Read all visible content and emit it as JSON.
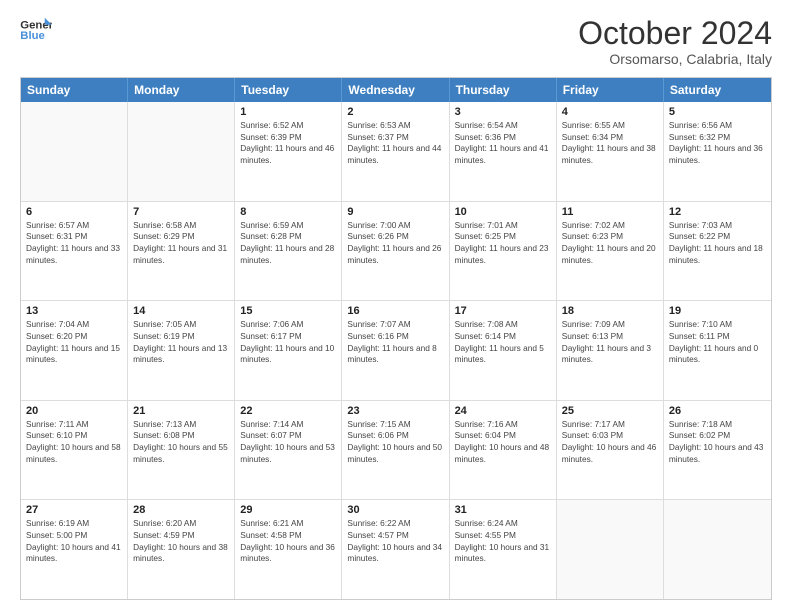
{
  "header": {
    "logo_line1": "General",
    "logo_line2": "Blue",
    "month_title": "October 2024",
    "location": "Orsomarso, Calabria, Italy"
  },
  "weekdays": [
    "Sunday",
    "Monday",
    "Tuesday",
    "Wednesday",
    "Thursday",
    "Friday",
    "Saturday"
  ],
  "rows": [
    [
      {
        "day": "",
        "info": ""
      },
      {
        "day": "",
        "info": ""
      },
      {
        "day": "1",
        "info": "Sunrise: 6:52 AM\nSunset: 6:39 PM\nDaylight: 11 hours and 46 minutes."
      },
      {
        "day": "2",
        "info": "Sunrise: 6:53 AM\nSunset: 6:37 PM\nDaylight: 11 hours and 44 minutes."
      },
      {
        "day": "3",
        "info": "Sunrise: 6:54 AM\nSunset: 6:36 PM\nDaylight: 11 hours and 41 minutes."
      },
      {
        "day": "4",
        "info": "Sunrise: 6:55 AM\nSunset: 6:34 PM\nDaylight: 11 hours and 38 minutes."
      },
      {
        "day": "5",
        "info": "Sunrise: 6:56 AM\nSunset: 6:32 PM\nDaylight: 11 hours and 36 minutes."
      }
    ],
    [
      {
        "day": "6",
        "info": "Sunrise: 6:57 AM\nSunset: 6:31 PM\nDaylight: 11 hours and 33 minutes."
      },
      {
        "day": "7",
        "info": "Sunrise: 6:58 AM\nSunset: 6:29 PM\nDaylight: 11 hours and 31 minutes."
      },
      {
        "day": "8",
        "info": "Sunrise: 6:59 AM\nSunset: 6:28 PM\nDaylight: 11 hours and 28 minutes."
      },
      {
        "day": "9",
        "info": "Sunrise: 7:00 AM\nSunset: 6:26 PM\nDaylight: 11 hours and 26 minutes."
      },
      {
        "day": "10",
        "info": "Sunrise: 7:01 AM\nSunset: 6:25 PM\nDaylight: 11 hours and 23 minutes."
      },
      {
        "day": "11",
        "info": "Sunrise: 7:02 AM\nSunset: 6:23 PM\nDaylight: 11 hours and 20 minutes."
      },
      {
        "day": "12",
        "info": "Sunrise: 7:03 AM\nSunset: 6:22 PM\nDaylight: 11 hours and 18 minutes."
      }
    ],
    [
      {
        "day": "13",
        "info": "Sunrise: 7:04 AM\nSunset: 6:20 PM\nDaylight: 11 hours and 15 minutes."
      },
      {
        "day": "14",
        "info": "Sunrise: 7:05 AM\nSunset: 6:19 PM\nDaylight: 11 hours and 13 minutes."
      },
      {
        "day": "15",
        "info": "Sunrise: 7:06 AM\nSunset: 6:17 PM\nDaylight: 11 hours and 10 minutes."
      },
      {
        "day": "16",
        "info": "Sunrise: 7:07 AM\nSunset: 6:16 PM\nDaylight: 11 hours and 8 minutes."
      },
      {
        "day": "17",
        "info": "Sunrise: 7:08 AM\nSunset: 6:14 PM\nDaylight: 11 hours and 5 minutes."
      },
      {
        "day": "18",
        "info": "Sunrise: 7:09 AM\nSunset: 6:13 PM\nDaylight: 11 hours and 3 minutes."
      },
      {
        "day": "19",
        "info": "Sunrise: 7:10 AM\nSunset: 6:11 PM\nDaylight: 11 hours and 0 minutes."
      }
    ],
    [
      {
        "day": "20",
        "info": "Sunrise: 7:11 AM\nSunset: 6:10 PM\nDaylight: 10 hours and 58 minutes."
      },
      {
        "day": "21",
        "info": "Sunrise: 7:13 AM\nSunset: 6:08 PM\nDaylight: 10 hours and 55 minutes."
      },
      {
        "day": "22",
        "info": "Sunrise: 7:14 AM\nSunset: 6:07 PM\nDaylight: 10 hours and 53 minutes."
      },
      {
        "day": "23",
        "info": "Sunrise: 7:15 AM\nSunset: 6:06 PM\nDaylight: 10 hours and 50 minutes."
      },
      {
        "day": "24",
        "info": "Sunrise: 7:16 AM\nSunset: 6:04 PM\nDaylight: 10 hours and 48 minutes."
      },
      {
        "day": "25",
        "info": "Sunrise: 7:17 AM\nSunset: 6:03 PM\nDaylight: 10 hours and 46 minutes."
      },
      {
        "day": "26",
        "info": "Sunrise: 7:18 AM\nSunset: 6:02 PM\nDaylight: 10 hours and 43 minutes."
      }
    ],
    [
      {
        "day": "27",
        "info": "Sunrise: 6:19 AM\nSunset: 5:00 PM\nDaylight: 10 hours and 41 minutes."
      },
      {
        "day": "28",
        "info": "Sunrise: 6:20 AM\nSunset: 4:59 PM\nDaylight: 10 hours and 38 minutes."
      },
      {
        "day": "29",
        "info": "Sunrise: 6:21 AM\nSunset: 4:58 PM\nDaylight: 10 hours and 36 minutes."
      },
      {
        "day": "30",
        "info": "Sunrise: 6:22 AM\nSunset: 4:57 PM\nDaylight: 10 hours and 34 minutes."
      },
      {
        "day": "31",
        "info": "Sunrise: 6:24 AM\nSunset: 4:55 PM\nDaylight: 10 hours and 31 minutes."
      },
      {
        "day": "",
        "info": ""
      },
      {
        "day": "",
        "info": ""
      }
    ]
  ]
}
